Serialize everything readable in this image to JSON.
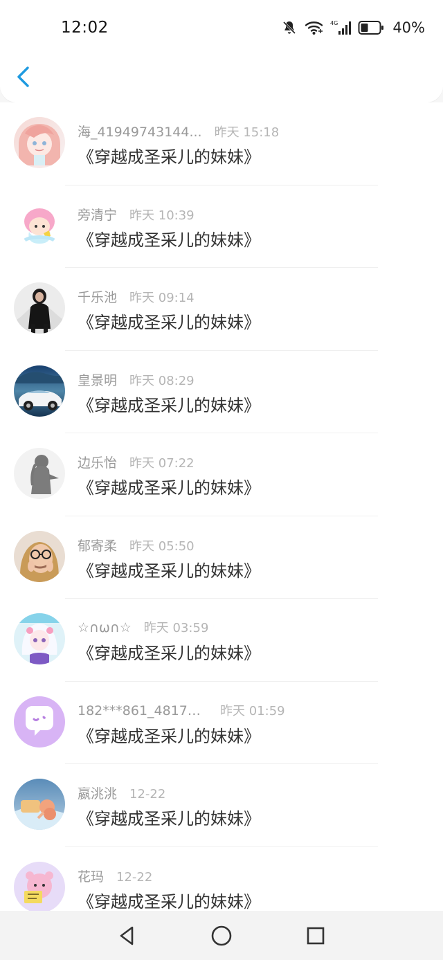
{
  "status_bar": {
    "time": "12:02",
    "battery_percent": "40%"
  },
  "header": {
    "back_icon": "chevron-left-icon",
    "accent_color": "#1e9ae0"
  },
  "list_items": [
    {
      "name": "海_41949743144...",
      "time": "昨天 15:18",
      "message": "《穿越成圣采儿的妹妹》",
      "avatar": "anime-girl-pink-avatar"
    },
    {
      "name": "旁清宁",
      "time": "昨天 10:39",
      "message": "《穿越成圣采儿的妹妹》",
      "avatar": "cartoon-character-avatar"
    },
    {
      "name": "千乐池",
      "time": "昨天 09:14",
      "message": "《穿越成圣采儿的妹妹》",
      "avatar": "girl-photo-avatar"
    },
    {
      "name": "皇景明",
      "time": "昨天 08:29",
      "message": "《穿越成圣采儿的妹妹》",
      "avatar": "white-car-avatar"
    },
    {
      "name": "边乐怡",
      "time": "昨天 07:22",
      "message": "《穿越成圣采儿的妹妹》",
      "avatar": "silhouette-girl-avatar"
    },
    {
      "name": "郁寄柔",
      "time": "昨天 05:50",
      "message": "《穿越成圣采儿的妹妹》",
      "avatar": "glasses-girl-avatar"
    },
    {
      "name": "☆∩ω∩☆",
      "time": "昨天 03:59",
      "message": "《穿越成圣采儿的妹妹》",
      "avatar": "anime-white-hair-avatar"
    },
    {
      "name": "182***861_48177...",
      "time": "昨天 01:59",
      "message": "《穿越成圣采儿的妹妹》",
      "avatar": "purple-chat-bubble-avatar"
    },
    {
      "name": "嬴洮洮",
      "time": "12-22",
      "message": "《穿越成圣采儿的妹妹》",
      "avatar": "sky-cartoon-avatar"
    },
    {
      "name": "花玛",
      "time": "12-22",
      "message": "《穿越成圣采儿的妹妹》",
      "avatar": "pink-bear-avatar"
    }
  ],
  "nav_bar": {
    "back_icon": "triangle-back-icon",
    "home_icon": "circle-home-icon",
    "recent_icon": "square-recent-icon"
  }
}
